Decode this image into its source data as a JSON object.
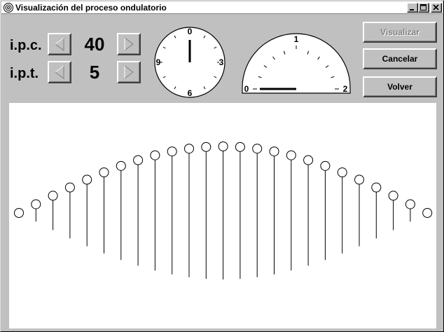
{
  "window": {
    "title": "Visualización del proceso ondulatorio",
    "app_icon": "spiral-icon",
    "minimize_icon": "minimize-icon",
    "maximize_icon": "maximize-icon",
    "close_icon": "close-icon"
  },
  "controls": {
    "ipc": {
      "label": "i.p.c.",
      "value": "40",
      "left_icon": "left-arrow-icon",
      "right_icon": "right-arrow-icon"
    },
    "ipt": {
      "label": "i.p.t.",
      "value": "5",
      "left_icon": "left-arrow-icon",
      "right_icon": "right-arrow-icon"
    }
  },
  "clock": {
    "labels": {
      "top": "0",
      "right": "3",
      "bottom": "6",
      "left": "9"
    },
    "hand_value": 0
  },
  "gauge": {
    "labels": {
      "left": "0",
      "top": "1",
      "right": "2"
    },
    "needle_value": 0
  },
  "buttons": {
    "visualizar": {
      "label": "Visualizar",
      "enabled": false
    },
    "cancelar": {
      "label": "Cancelar",
      "enabled": true
    },
    "volver": {
      "label": "Volver",
      "enabled": true
    }
  },
  "wave": {
    "num_particles": 25,
    "amplitude_profile": "sine-half-period",
    "phase": 0
  }
}
